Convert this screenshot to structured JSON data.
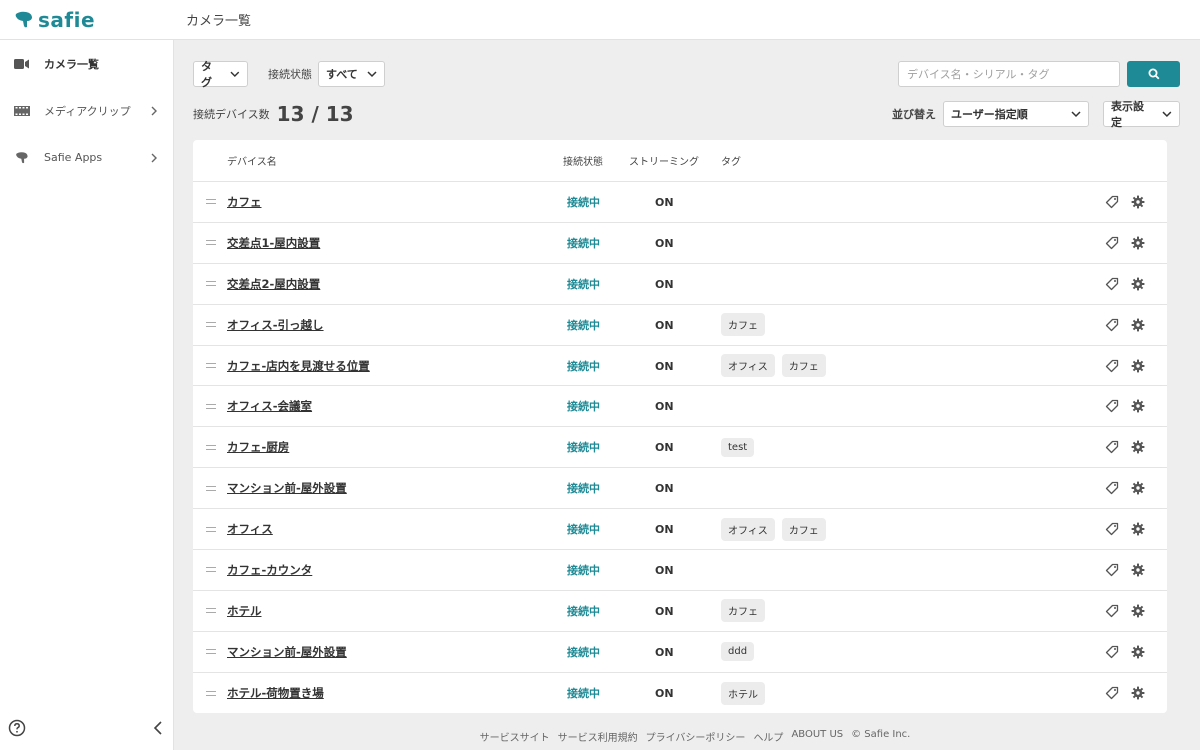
{
  "app": {
    "logo_text": "safie",
    "page_title": "カメラ一覧"
  },
  "sidebar": {
    "items": [
      {
        "label": "カメラ一覧",
        "icon": "video-camera-icon"
      },
      {
        "label": "メディアクリップ",
        "icon": "film-strip-icon"
      },
      {
        "label": "Safie Apps",
        "icon": "safie-logo-icon"
      }
    ]
  },
  "filters": {
    "tag_select": "タグ",
    "connection_label": "接続状態",
    "connection_select": "すべて",
    "search_placeholder": "デバイス名・シリアル・タグ"
  },
  "summary": {
    "count_label": "接続デバイス数",
    "count_value": "13 / 13",
    "sort_label": "並び替え",
    "sort_select": "ユーザー指定順",
    "display_settings": "表示設定"
  },
  "table": {
    "headers": {
      "name": "デバイス名",
      "status": "接続状態",
      "streaming": "ストリーミング",
      "tags": "タグ"
    },
    "rows": [
      {
        "name": "カフェ",
        "status": "接続中",
        "streaming": "ON",
        "tags": []
      },
      {
        "name": "交差点1-屋内設置",
        "status": "接続中",
        "streaming": "ON",
        "tags": []
      },
      {
        "name": "交差点2-屋内設置",
        "status": "接続中",
        "streaming": "ON",
        "tags": []
      },
      {
        "name": "オフィス-引っ越し",
        "status": "接続中",
        "streaming": "ON",
        "tags": [
          "カフェ"
        ]
      },
      {
        "name": "カフェ-店内を見渡せる位置",
        "status": "接続中",
        "streaming": "ON",
        "tags": [
          "オフィス",
          "カフェ"
        ]
      },
      {
        "name": "オフィス-会議室",
        "status": "接続中",
        "streaming": "ON",
        "tags": []
      },
      {
        "name": "カフェ-厨房",
        "status": "接続中",
        "streaming": "ON",
        "tags": [
          "test"
        ]
      },
      {
        "name": "マンション前-屋外設置",
        "status": "接続中",
        "streaming": "ON",
        "tags": []
      },
      {
        "name": "オフィス",
        "status": "接続中",
        "streaming": "ON",
        "tags": [
          "オフィス",
          "カフェ"
        ]
      },
      {
        "name": "カフェ-カウンタ",
        "status": "接続中",
        "streaming": "ON",
        "tags": []
      },
      {
        "name": "ホテル",
        "status": "接続中",
        "streaming": "ON",
        "tags": [
          "カフェ"
        ]
      },
      {
        "name": "マンション前-屋外設置",
        "status": "接続中",
        "streaming": "ON",
        "tags": [
          "ddd"
        ]
      },
      {
        "name": "ホテル-荷物置き場",
        "status": "接続中",
        "streaming": "ON",
        "tags": [
          "ホテル"
        ]
      }
    ]
  },
  "footer": {
    "links": [
      "サービスサイト",
      "サービス利用規約",
      "プライバシーポリシー",
      "ヘルプ",
      "ABOUT US",
      "© Safie Inc."
    ]
  },
  "colors": {
    "brand": "#1e8a95",
    "background": "#eeeeee"
  }
}
